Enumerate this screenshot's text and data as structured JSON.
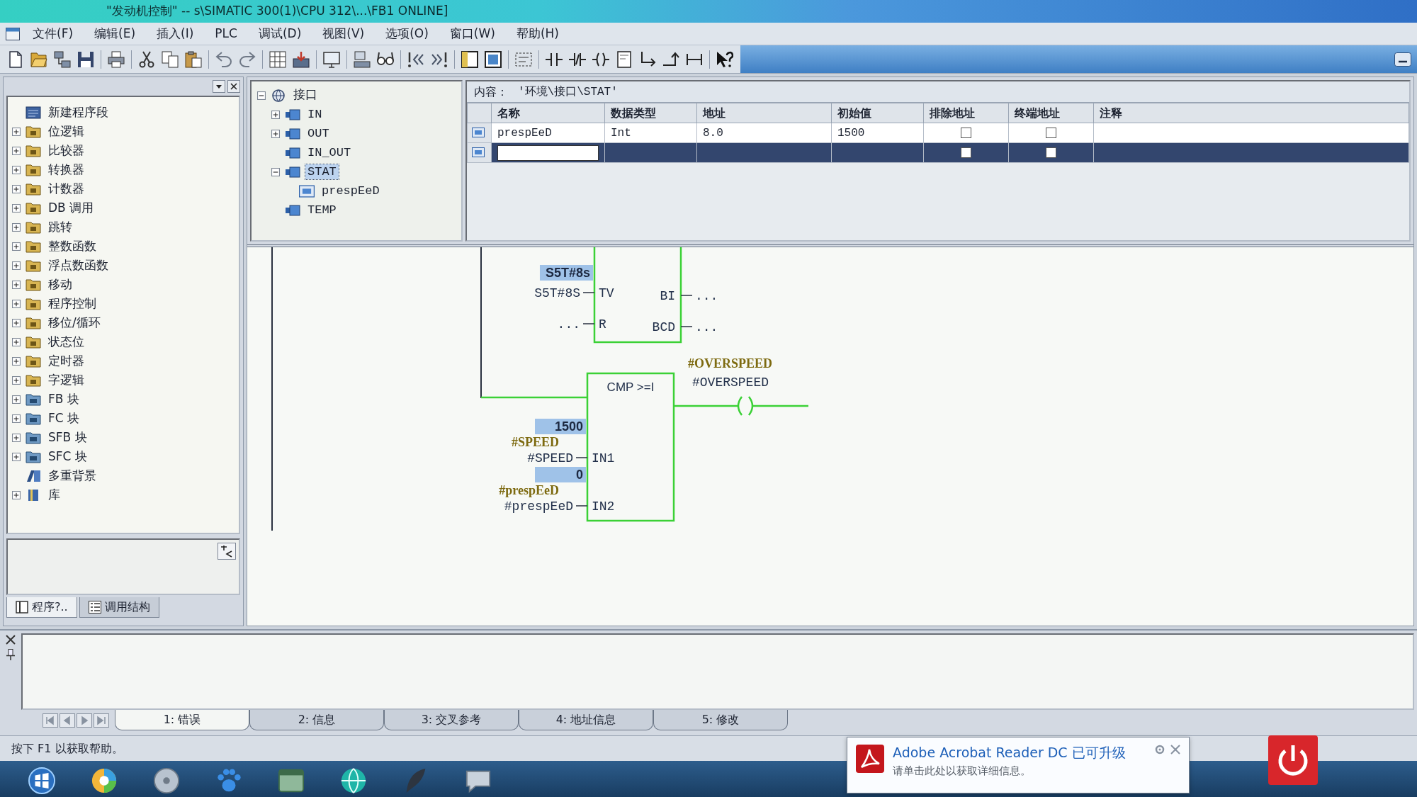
{
  "window": {
    "title": "\"发动机控制\" -- s\\SIMATIC 300(1)\\CPU 312\\...\\FB1 ONLINE]"
  },
  "menu": [
    "文件(F)",
    "编辑(E)",
    "插入(I)",
    "PLC",
    "调试(D)",
    "视图(V)",
    "选项(O)",
    "窗口(W)",
    "帮助(H)"
  ],
  "program_elements": {
    "items": [
      {
        "label": "新建程序段",
        "kind": "network",
        "expandable": false,
        "expanded": false
      },
      {
        "label": "位逻辑",
        "kind": "folder",
        "expandable": true,
        "expanded": false
      },
      {
        "label": "比较器",
        "kind": "folder",
        "expandable": true,
        "expanded": false
      },
      {
        "label": "转换器",
        "kind": "folder",
        "expandable": true,
        "expanded": false
      },
      {
        "label": "计数器",
        "kind": "folder",
        "expandable": true,
        "expanded": false
      },
      {
        "label": "DB 调用",
        "kind": "folder",
        "expandable": true,
        "expanded": false
      },
      {
        "label": "跳转",
        "kind": "folder",
        "expandable": true,
        "expanded": false
      },
      {
        "label": "整数函数",
        "kind": "folder",
        "expandable": true,
        "expanded": false
      },
      {
        "label": "浮点数函数",
        "kind": "folder",
        "expandable": true,
        "expanded": false
      },
      {
        "label": "移动",
        "kind": "folder",
        "expandable": true,
        "expanded": false
      },
      {
        "label": "程序控制",
        "kind": "folder",
        "expandable": true,
        "expanded": false
      },
      {
        "label": "移位/循环",
        "kind": "folder",
        "expandable": true,
        "expanded": false
      },
      {
        "label": "状态位",
        "kind": "folder",
        "expandable": true,
        "expanded": false
      },
      {
        "label": "定时器",
        "kind": "folder",
        "expandable": true,
        "expanded": false
      },
      {
        "label": "字逻辑",
        "kind": "folder",
        "expandable": true,
        "expanded": false
      },
      {
        "label": "FB 块",
        "kind": "block_folder",
        "expandable": true,
        "expanded": false
      },
      {
        "label": "FC 块",
        "kind": "block_folder",
        "expandable": true,
        "expanded": false
      },
      {
        "label": "SFB 块",
        "kind": "block_folder",
        "expandable": true,
        "expanded": false
      },
      {
        "label": "SFC 块",
        "kind": "block_folder",
        "expandable": true,
        "expanded": false
      },
      {
        "label": "多重背景",
        "kind": "multi_instance",
        "expandable": false,
        "expanded": false
      },
      {
        "label": "库",
        "kind": "library",
        "expandable": true,
        "expanded": false
      }
    ],
    "tabs": [
      {
        "label": "程序?..",
        "kind": "program",
        "selected": true
      },
      {
        "label": "调用结构",
        "kind": "call_structure",
        "selected": false
      }
    ]
  },
  "interface_tree": [
    {
      "label": "接口",
      "kind": "root",
      "expandable": true,
      "expanded": true,
      "selected": false,
      "children": [
        {
          "label": "IN",
          "kind": "section",
          "expandable": true,
          "expanded": false,
          "selected": false
        },
        {
          "label": "OUT",
          "kind": "section",
          "expandable": true,
          "expanded": false,
          "selected": false
        },
        {
          "label": "IN_OUT",
          "kind": "section",
          "expandable": false,
          "expanded": false,
          "selected": false
        },
        {
          "label": "STAT",
          "kind": "section",
          "expandable": true,
          "expanded": true,
          "selected": true,
          "children": [
            {
              "label": "prespEeD",
              "kind": "variable",
              "expandable": false,
              "expanded": false,
              "selected": false
            }
          ]
        },
        {
          "label": "TEMP",
          "kind": "section",
          "expandable": false,
          "expanded": false,
          "selected": false
        }
      ]
    }
  ],
  "variable_table": {
    "caption": "内容：",
    "path": "'环境\\接口\\STAT'",
    "columns": [
      "名称",
      "数据类型",
      "地址",
      "初始值",
      "排除地址",
      "终端地址",
      "注释"
    ],
    "rows": [
      {
        "selected": false,
        "editing": false,
        "cells": [
          "prespEeD",
          "Int",
          "8.0",
          "1500"
        ],
        "exclude_address": false,
        "terminal_address": false
      },
      {
        "selected": true,
        "editing": true,
        "exclude_address": false,
        "terminal_address": false
      }
    ]
  },
  "ladder": {
    "timer": {
      "powered": true,
      "inputs": [
        {
          "pin": "TV",
          "operand": "S5T#8S",
          "status": "S5T#8s"
        },
        {
          "pin": "R",
          "operand": "..."
        }
      ],
      "outputs": [
        {
          "pin": "BI",
          "operand": "..."
        },
        {
          "pin": "BCD",
          "operand": "..."
        }
      ]
    },
    "compare": {
      "title": "CMP >=I",
      "powered": true,
      "inputs": [
        {
          "pin": "IN1",
          "operand": "#SPEED",
          "symbol": "#SPEED",
          "status": "1500"
        },
        {
          "pin": "IN2",
          "operand": "#prespEeD",
          "symbol": "#prespEeD",
          "status": "0"
        }
      ]
    },
    "coil": {
      "operand": "#OVERSPEED",
      "symbol": "#OVERSPEED",
      "powered": true
    }
  },
  "details": {
    "tabs": [
      {
        "label": "1: 错误",
        "selected": true
      },
      {
        "label": "2: 信息",
        "selected": false
      },
      {
        "label": "3: 交叉参考",
        "selected": false
      },
      {
        "label": "4: 地址信息",
        "selected": false
      },
      {
        "label": "5: 修改",
        "selected": false
      }
    ]
  },
  "status_bar": {
    "text": "按下 F1 以获取帮助。"
  },
  "notification": {
    "title": "Adobe Acrobat Reader DC 已可升级",
    "message": "请单击此处以获取详细信息。"
  }
}
